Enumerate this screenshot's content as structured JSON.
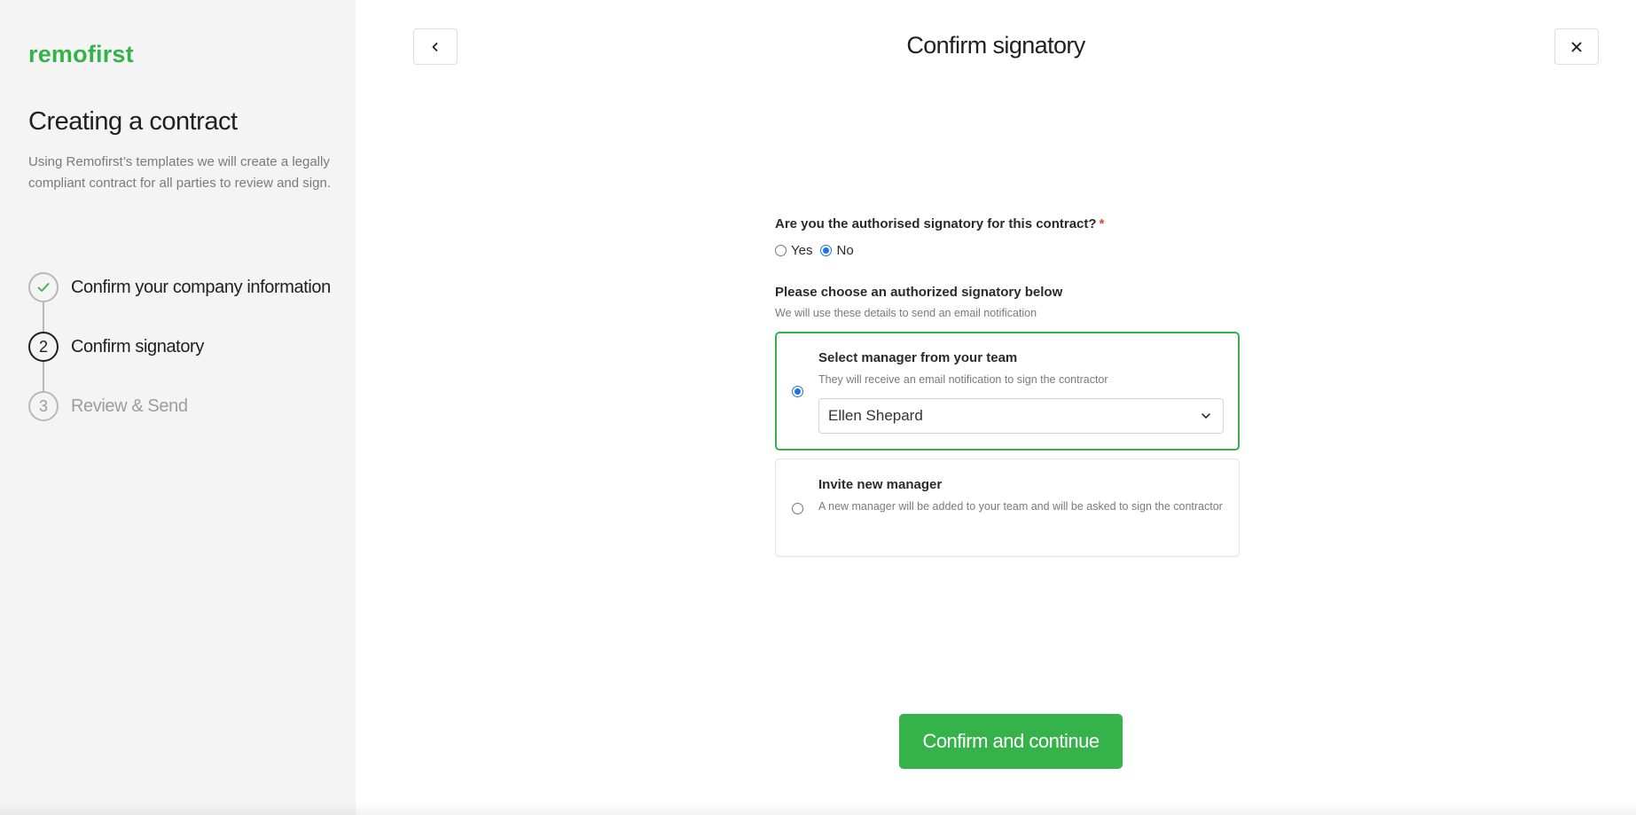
{
  "sidebar": {
    "logo": "remofirst",
    "title": "Creating a contract",
    "description": "Using Remofirst’s templates we will create a legally compliant contract for all parties to review and sign.",
    "steps": [
      {
        "marker": "",
        "label": "Confirm your company information",
        "status": "done"
      },
      {
        "marker": "2",
        "label": "Confirm signatory",
        "status": "active"
      },
      {
        "marker": "3",
        "label": "Review & Send",
        "status": "pending"
      }
    ]
  },
  "header": {
    "title": "Confirm signatory",
    "back_icon": "chevron-left-icon",
    "close_icon": "close-icon"
  },
  "form": {
    "question": "Are you the authorised signatory for this contract?",
    "required_mark": "*",
    "options": [
      {
        "label": "Yes",
        "checked": false
      },
      {
        "label": "No",
        "checked": true
      }
    ],
    "signatory_label": "Please choose an authorized signatory below",
    "signatory_hint": "We will use these details to send an email notification",
    "cards": [
      {
        "title": "Select manager from your team",
        "description": "They will receive an email notification to sign the contractor",
        "selected": true,
        "select_value": "Ellen Shepard"
      },
      {
        "title": "Invite new manager",
        "description": "A new manager will be added to your team and will be asked to sign the contractor",
        "selected": false
      }
    ]
  },
  "cta": {
    "label": "Confirm and continue"
  },
  "colors": {
    "accent": "#36b24a",
    "radio": "#1a73e8",
    "required": "#e0453a"
  }
}
